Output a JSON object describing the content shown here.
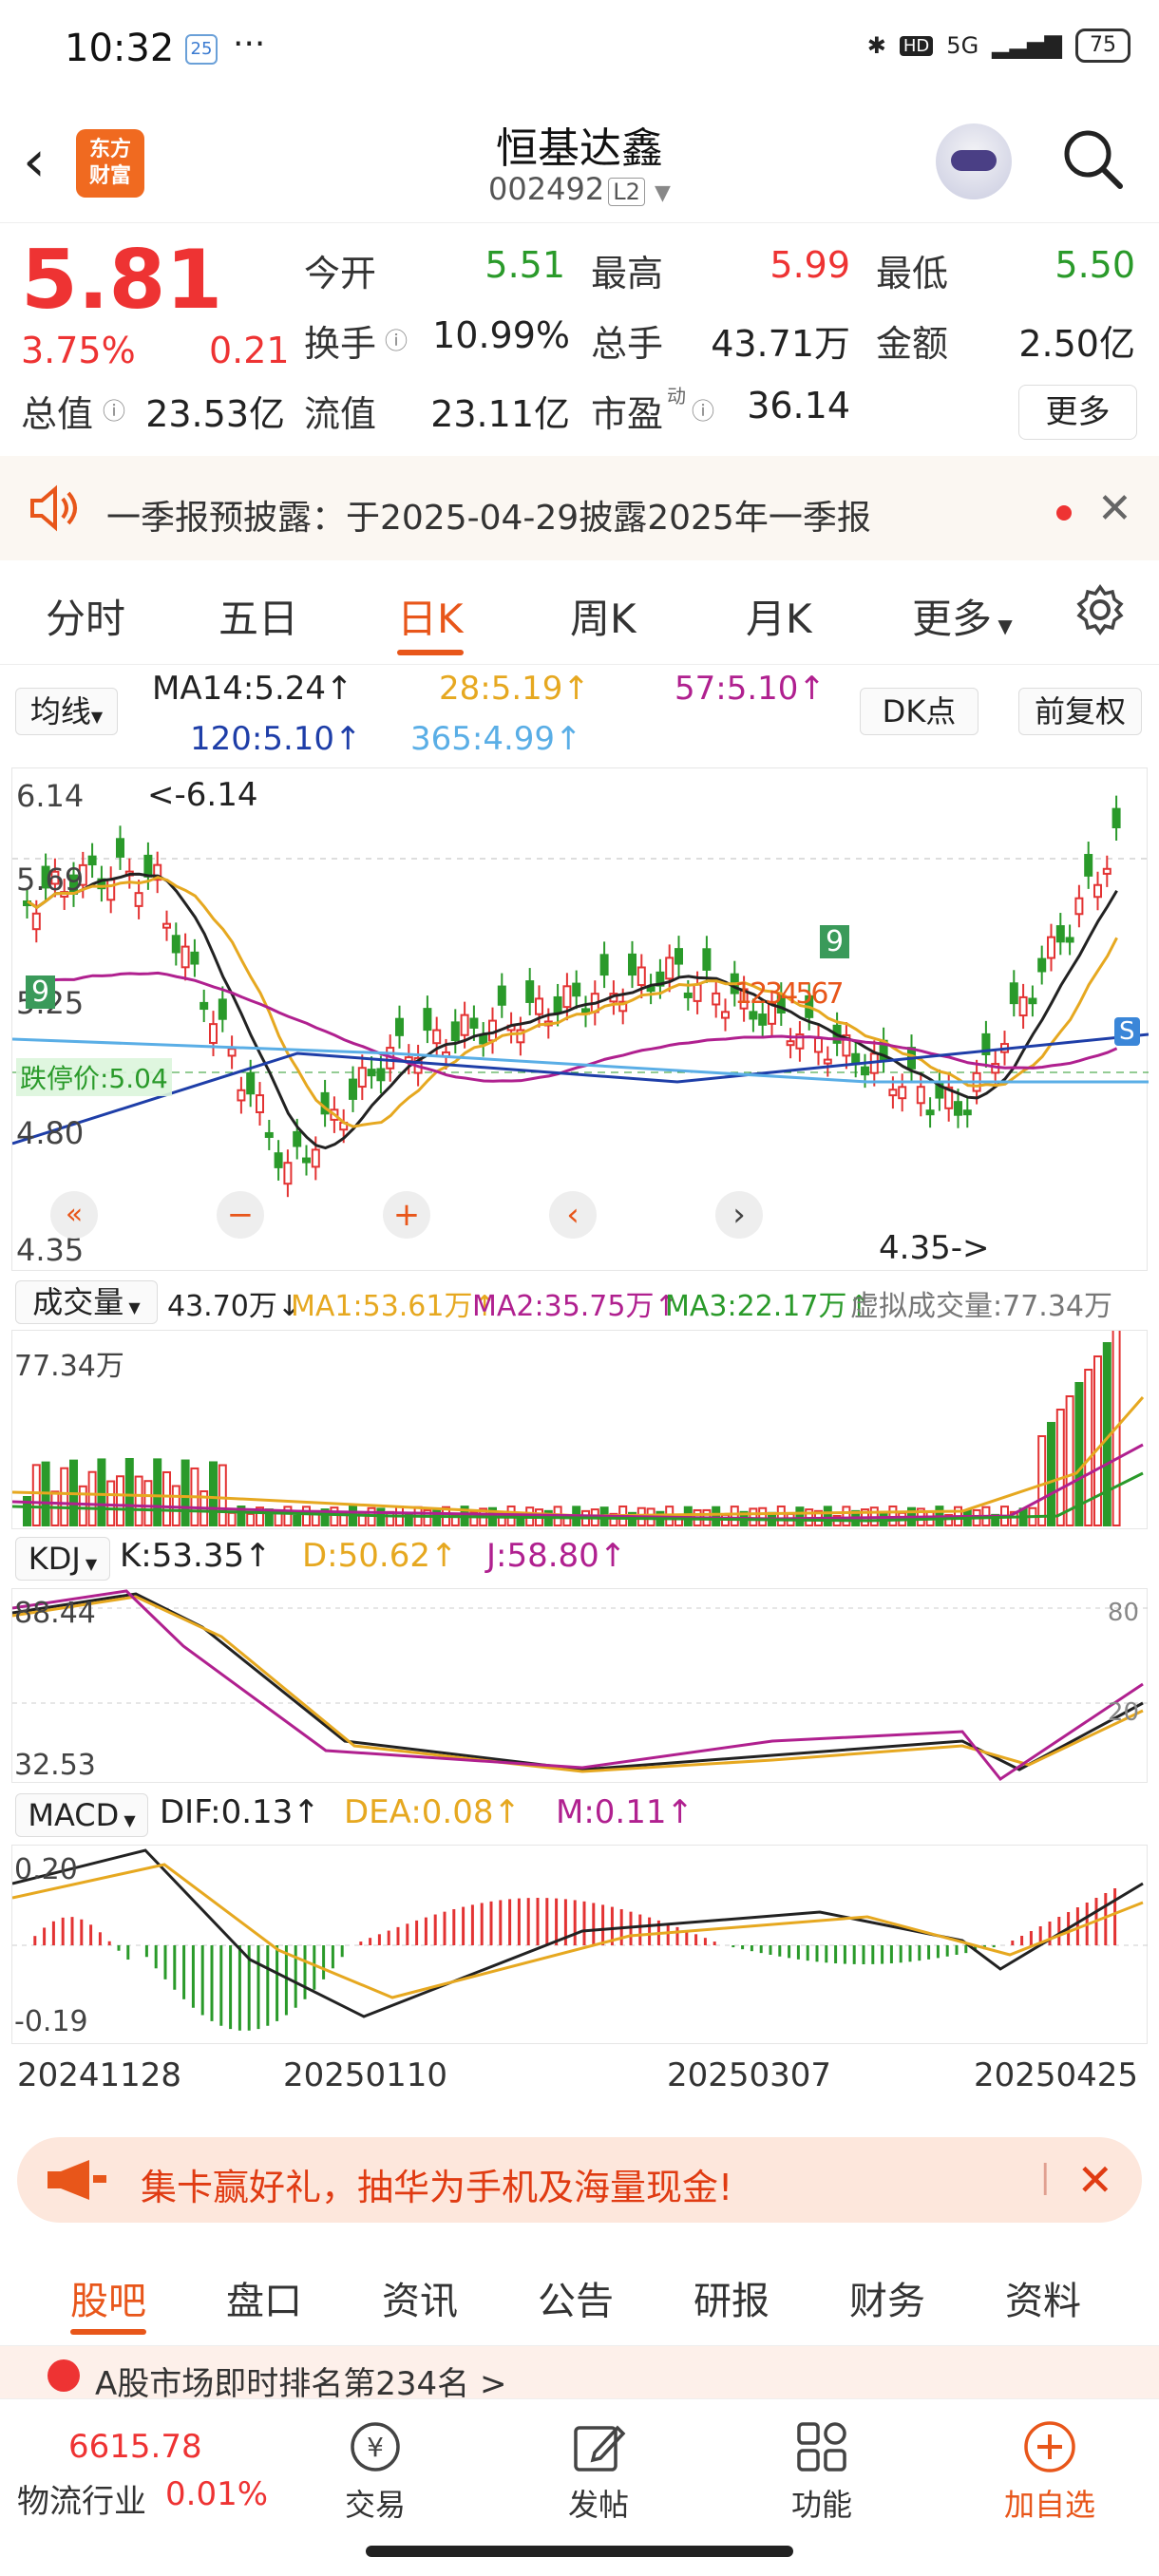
{
  "status_bar": {
    "time": "10:32",
    "badge": "25",
    "dots": "···",
    "network": "5G",
    "battery": "75"
  },
  "header": {
    "logo_text": "东方\n财富",
    "title": "恒基达鑫",
    "code": "002492",
    "level": "L2"
  },
  "quote": {
    "price": "5.81",
    "change_pct": "3.75%",
    "change": "0.21",
    "items": [
      {
        "label": "今开",
        "value": "5.51"
      },
      {
        "label": "最高",
        "value": "5.99"
      },
      {
        "label": "最低",
        "value": "5.50"
      },
      {
        "label": "换手",
        "value": "10.99%"
      },
      {
        "label": "总手",
        "value": "43.71万"
      },
      {
        "label": "金额",
        "value": "2.50亿"
      },
      {
        "label": "总值",
        "value": "23.53亿"
      },
      {
        "label": "流值",
        "value": "23.11亿"
      },
      {
        "label": "市盈",
        "value": "36.14"
      }
    ],
    "pe_sup": "动",
    "more": "更多"
  },
  "notice": {
    "text": "一季报预披露：于2025-04-29披露2025年一季报"
  },
  "chart_tabs": [
    "分时",
    "五日",
    "日K",
    "周K",
    "月K",
    "更多"
  ],
  "kline": {
    "ma_selector": "均线",
    "ma14": "MA14:5.24",
    "ma28": "28:5.19",
    "ma57": "57:5.10",
    "ma120": "120:5.10",
    "ma365": "365:4.99",
    "dk": "DK点",
    "adjust": "前复权",
    "y_labels": [
      "6.14",
      "5.69",
      "5.25",
      "4.80",
      "4.35"
    ],
    "high_marker": "<-6.14",
    "low_marker": "4.35->",
    "limit_down": "跌停价:5.04",
    "signal_9": "9",
    "signal_seq": "1234567"
  },
  "volume": {
    "selector": "成交量",
    "value": "43.70万",
    "ma1": "MA1:53.61万",
    "ma2": "MA2:35.75万",
    "ma3": "MA3:22.17万",
    "virtual": "虚拟成交量:77.34万",
    "top": "77.34万"
  },
  "kdj": {
    "selector": "KDJ",
    "k": "K:53.35",
    "d": "D:50.62",
    "j": "J:58.80",
    "top": "88.44",
    "bottom": "32.53",
    "r80": "80",
    "r20": "20"
  },
  "macd": {
    "selector": "MACD",
    "dif": "DIF:0.13",
    "dea": "DEA:0.08",
    "m": "M:0.11",
    "top": "0.20",
    "bottom": "-0.19"
  },
  "dates": [
    "20241128",
    "20250110",
    "20250307",
    "20250425"
  ],
  "promo": {
    "text": "集卡赢好礼，抽华为手机及海量现金!"
  },
  "bottom_tabs": [
    "股吧",
    "盘口",
    "资讯",
    "公告",
    "研报",
    "财务",
    "资料"
  ],
  "rank": {
    "text": "A股市场即时排名第234名 >"
  },
  "navbar": {
    "index_value": "6615.78",
    "index_name": "物流行业",
    "index_change": "0.01%",
    "items": [
      "交易",
      "发帖",
      "功能",
      "加自选"
    ]
  },
  "colors": {
    "up": "#e33333",
    "down": "#2a9a2a",
    "accent": "#e8561a"
  }
}
